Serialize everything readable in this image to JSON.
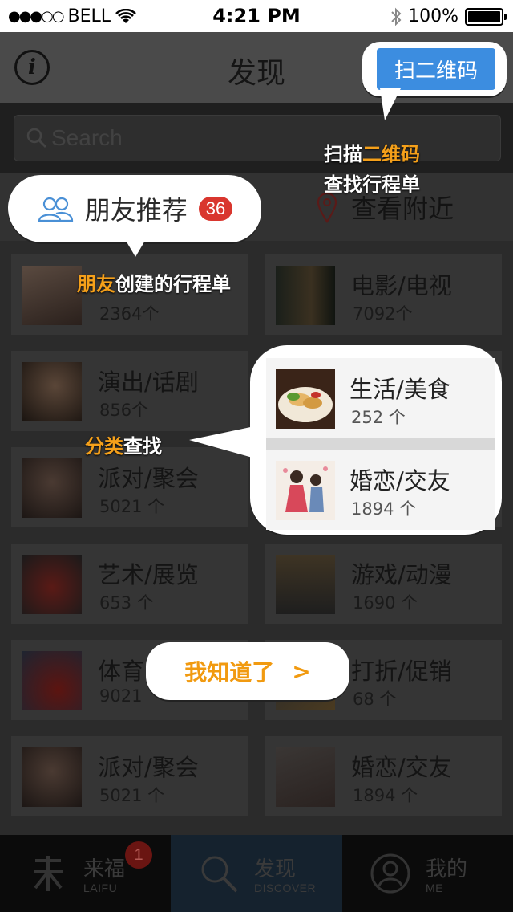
{
  "status_bar": {
    "signal": "●●●○○",
    "carrier": "BELL",
    "time": "4:21 PM",
    "battery": "100%",
    "battery_level": 1.0
  },
  "nav": {
    "title": "发现",
    "info_glyph": "i",
    "scan_label": "扫二维码"
  },
  "search": {
    "placeholder": "Search"
  },
  "segment": {
    "friends_label": "朋友推荐",
    "friends_badge": "36",
    "nearby_label": "查看附近"
  },
  "cards": [
    {
      "name": "",
      "count": "2364个"
    },
    {
      "name": "电影/电视",
      "count": "7092个"
    },
    {
      "name": "演出/话剧",
      "count": "856个"
    },
    {
      "name": "生活/美食",
      "count": "252 个"
    },
    {
      "name": "派对/聚会",
      "count": "5021 个"
    },
    {
      "name": "婚恋/交友",
      "count": "1894 个"
    },
    {
      "name": "艺术/展览",
      "count": "653 个"
    },
    {
      "name": "游戏/动漫",
      "count": "1690 个"
    },
    {
      "name": "体育",
      "count": "9021"
    },
    {
      "name": "打折/促销",
      "count": "68 个"
    },
    {
      "name": "派对/聚会",
      "count": "5021 个"
    },
    {
      "name": "婚恋/交友",
      "count": "1894 个"
    }
  ],
  "annotations": {
    "scan_line1_a": "扫描",
    "scan_line1_b": "二维码",
    "scan_line2": "查找行程单",
    "friend_a": "朋友",
    "friend_b": "创建的行程单",
    "cat_a": "分类",
    "cat_b": "查找",
    "ok_label": "我知道了",
    "ok_arrow": ">"
  },
  "tabbar": {
    "tabs": [
      {
        "label": "来福",
        "sub": "LAIFU",
        "badge": "1"
      },
      {
        "label": "发现",
        "sub": "DISCOVER"
      },
      {
        "label": "我的",
        "sub": "ME"
      }
    ]
  },
  "colors": {
    "accent": "#3c8de0",
    "highlight": "#f5a01a",
    "badge": "#d9362e"
  }
}
